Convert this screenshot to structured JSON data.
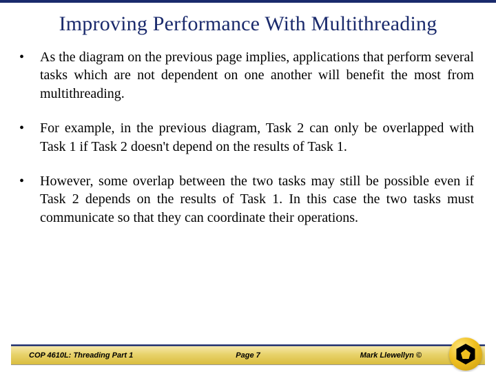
{
  "title": "Improving Performance With Multithreading",
  "bullets": [
    "As the diagram on the previous page implies, applications that perform several tasks which are not dependent on one another will benefit the most from multithreading.",
    "For example, in the previous diagram, Task 2 can only be overlapped with Task 1 if Task 2 doesn't depend on the results of Task 1.",
    "However, some overlap between the two tasks may still be possible even if Task 2 depends on the results of Task 1.  In this case the two tasks must communicate so that they can coordinate their operations."
  ],
  "footer": {
    "left": "COP 4610L: Threading Part 1",
    "center": "Page 7",
    "right": "Mark Llewellyn ©"
  }
}
